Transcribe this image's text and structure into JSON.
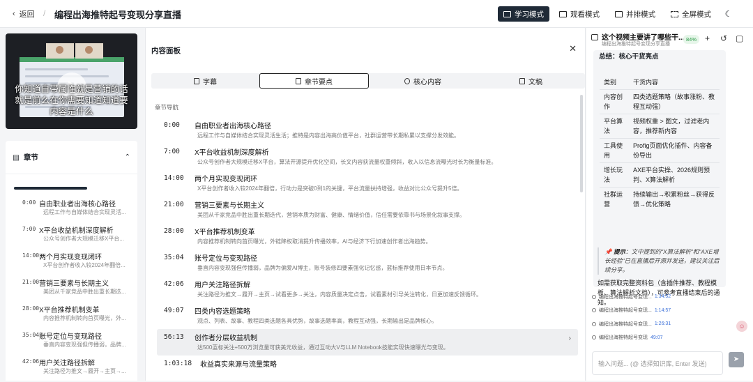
{
  "header": {
    "back_label": "返回",
    "title": "编程出海推特起号变现分享直播",
    "modes": [
      {
        "label": "学习模式",
        "active": true
      },
      {
        "label": "观看模式",
        "active": false
      },
      {
        "label": "并排模式",
        "active": false
      },
      {
        "label": "全屏模式",
        "active": false
      }
    ]
  },
  "video": {
    "subtitle": "你知道自带属性就是营销的话就是前么在你需要知道知道要内容是什么"
  },
  "chapters": {
    "title": "章节",
    "progress": 0.55,
    "items": [
      {
        "time": "0:00",
        "name": "自由职业者出海核心路径",
        "desc": "远程工作与自媒体结合实现灵活..."
      },
      {
        "time": "7:00",
        "name": "X平台收益机制深度解析",
        "desc": "公众号创作者大规模迁移X平台..."
      },
      {
        "time": "14:00",
        "name": "两个月实现变现闭环",
        "desc": "X平台创作者收入较2024年翻倍..."
      },
      {
        "time": "21:00",
        "name": "营销三要素与长期主义",
        "desc": "美团从千家竞品中胜出重长期迭..."
      },
      {
        "time": "28:00",
        "name": "X平台推荐机制变革",
        "desc": "内容推荐机制转向首页曝光，外..."
      },
      {
        "time": "35:04",
        "name": "账号定位与变现路径",
        "desc": "垂直内容变现强但传播弱，品牌..."
      },
      {
        "time": "42:06",
        "name": "用户关注路径拆解",
        "desc": "关注路径为推文→履开→主页→..."
      }
    ]
  },
  "content_panel": {
    "title": "内容面板",
    "tabs": [
      {
        "label": "字幕",
        "active": false
      },
      {
        "label": "章节要点",
        "active": true
      },
      {
        "label": "核心内容",
        "active": false
      },
      {
        "label": "文稿",
        "active": false
      }
    ],
    "nav_label": "章节导航",
    "segments": [
      {
        "time": "0:00",
        "name": "自由职业者出海核心路径",
        "desc": "远程工作与自媒体结合实现灵活生活；推特是内容出海高价值平台，社群运营带长期私累以支撑分发效能。",
        "active": false
      },
      {
        "time": "7:00",
        "name": "X平台收益机制深度解析",
        "desc": "公众号创作者大规模迁移X平台，算法开源提升优化空间，长文内容获流量权重倾斜，收入以信息流曝光时长为衡量标准。",
        "active": false
      },
      {
        "time": "14:00",
        "name": "两个月实现变现闭环",
        "desc": "X平台创作者收入较2024年翻倍，行动力是突破0到1的关键，平台流量扶持增强，收益对比公众号提升5倍。",
        "active": false
      },
      {
        "time": "21:00",
        "name": "营销三要素与长期主义",
        "desc": "美团从千家竞品中胜出重长期迭代，营销本质为财富、健康、情绪价值，信任需要依靠书与场景化叙事支撑。",
        "active": false
      },
      {
        "time": "28:00",
        "name": "X平台推荐机制变革",
        "desc": "内容推荐机制转向首页曝光，外链降权取消提升传播效率，AI与经济下行加速创作者出海趋势。",
        "active": false
      },
      {
        "time": "35:04",
        "name": "账号定位与变现路径",
        "desc": "垂直内容变现强但传播弱，品牌为偏爱AI博主，账号装修四要素强化记忆感，蓝标推荐使用日本节点。",
        "active": false
      },
      {
        "time": "42:06",
        "name": "用户关注路径拆解",
        "desc": "关注路径为推文→履开→主页→试看更多→关注，内容质量决定点击，试看素材引导关注转化，日更加速反馈循环。",
        "active": false
      },
      {
        "time": "49:07",
        "name": "四类内容选题策略",
        "desc": "观点、列表、故事、教程四类选题各具优势，故事选题率高，教程互动强，长期输出是品牌核心。",
        "active": false
      },
      {
        "time": "56:13",
        "name": "创作者分层收益机制",
        "desc": "达500蓝标关注+500万浏览量可获美元收益，通过互动大V与LLM Notebook技能实现快速曝光与变现。",
        "active": true
      },
      {
        "time": "1:03:18",
        "name": "收益真实来源与流量策略",
        "desc": "",
        "active": false
      }
    ]
  },
  "chat": {
    "question": "这个视频主要讲了哪些干...",
    "video_name": "编程出海推特起号变现分享直播",
    "badge": "84%",
    "summary_title": "总结：核心干货亮点",
    "table": {
      "headers": [
        "类别",
        "干货内容"
      ],
      "rows": [
        [
          "内容创作",
          "四类选题策略（故事涨粉、教程互动强）"
        ],
        [
          "平台算法",
          "视频权重 > 图文，过滤老内容，推荐新内容"
        ],
        [
          "工具使用",
          "Profig页面优化插件、内容备份导出"
        ],
        [
          "增长玩法",
          "AXE平台实操、2026规则预判、X算法解析"
        ],
        [
          "社群运营",
          "持续输出→积累粉丝→获得反馈→优化策略"
        ]
      ]
    },
    "tip_label": "提示",
    "tip_text": "：文中提到的\"X算法解析\"和\"AXE增长经验\"已在直播后开源并发送，建议关注后续分享。",
    "tip_emphasis": "开源并发送",
    "note": "如需获取完整资料包（含插件推荐、教程模板、算法解析文档），可参考直播结束后的通知。",
    "refs": [
      {
        "label": "编程出海推特起号变现...",
        "ts": "1:34:52"
      },
      {
        "label": "编程出海推特起号变现...",
        "ts": "1:14:57"
      },
      {
        "label": "编程出海推特起号变现...",
        "ts": "1:26:31"
      },
      {
        "label": "编程出海推特起号变现",
        "ts": "49:07"
      }
    ],
    "input_placeholder": "输入问题... (@ 选择知识库, Enter 发送)"
  }
}
